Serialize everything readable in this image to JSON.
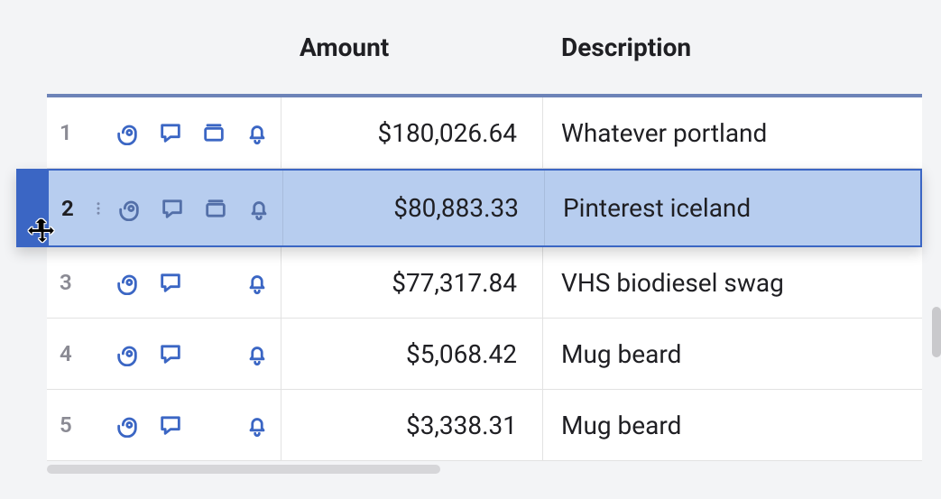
{
  "headers": {
    "amount": "Amount",
    "description": "Description"
  },
  "rows": [
    {
      "n": "1",
      "amount": "$180,026.64",
      "description": "Whatever portland",
      "selected": false,
      "icons": [
        "attach",
        "comment",
        "card",
        "bell"
      ]
    },
    {
      "n": "2",
      "amount": "$80,883.33",
      "description": "Pinterest iceland",
      "selected": true,
      "icons": [
        "attach",
        "comment",
        "card",
        "bell"
      ]
    },
    {
      "n": "3",
      "amount": "$77,317.84",
      "description": "VHS biodiesel swag",
      "selected": false,
      "icons": [
        "attach",
        "comment",
        "bell"
      ]
    },
    {
      "n": "4",
      "amount": "$5,068.42",
      "description": "Mug beard",
      "selected": false,
      "icons": [
        "attach",
        "comment",
        "bell"
      ]
    },
    {
      "n": "5",
      "amount": "$3,338.31",
      "description": "Mug beard",
      "selected": false,
      "icons": [
        "attach",
        "comment",
        "bell"
      ]
    }
  ],
  "icon_names": {
    "attach": "attachment-icon",
    "comment": "comment-icon",
    "card": "card-icon",
    "bell": "bell-icon",
    "dots": "more-dots-icon",
    "move": "move-cursor-icon"
  }
}
